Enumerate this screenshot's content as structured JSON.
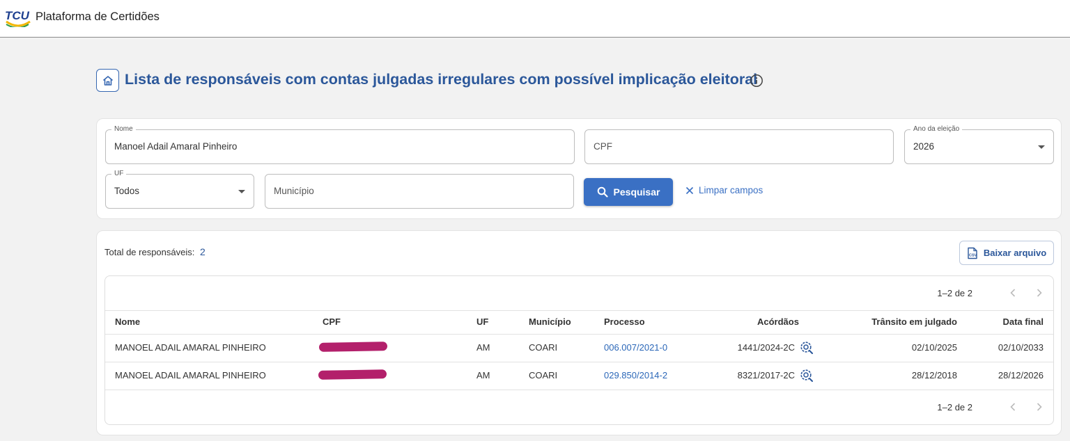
{
  "header": {
    "logo_text": "TCU",
    "app_title": "Plataforma de Certidões"
  },
  "page": {
    "title": "Lista de responsáveis com contas julgadas irregulares com possível implicação eleitoral"
  },
  "filters": {
    "nome": {
      "label": "Nome",
      "value": "Manoel Adail Amaral Pinheiro"
    },
    "cpf": {
      "placeholder": "CPF"
    },
    "ano": {
      "label": "Ano da eleição",
      "value": "2026"
    },
    "uf": {
      "label": "UF",
      "value": "Todos"
    },
    "municipio": {
      "placeholder": "Município"
    },
    "search_label": "Pesquisar",
    "clear_label": "Limpar campos"
  },
  "results": {
    "total_label": "Total de responsáveis:",
    "total_count": "2",
    "download_label": "Baixar arquivo",
    "pager_range": "1–2 de 2",
    "columns": [
      "Nome",
      "CPF",
      "UF",
      "Município",
      "Processo",
      "Acórdãos",
      "Trânsito em julgado",
      "Data final"
    ],
    "rows": [
      {
        "nome": "MANOEL ADAIL AMARAL PINHEIRO",
        "uf": "AM",
        "municipio": "COARI",
        "processo": "006.007/2021-0",
        "acordao": "1441/2024-2C",
        "transito": "02/10/2025",
        "data_final": "02/10/2033"
      },
      {
        "nome": "MANOEL ADAIL AMARAL PINHEIRO",
        "uf": "AM",
        "municipio": "COARI",
        "processo": "029.850/2014-2",
        "acordao": "8321/2017-2C",
        "transito": "28/12/2018",
        "data_final": "28/12/2026"
      }
    ]
  },
  "colors": {
    "primary": "#3a70c4",
    "title_blue": "#2b579a",
    "link_blue": "#2b67b8",
    "redaction": "#b3206b"
  },
  "icons": [
    "tcu-logo",
    "home-icon",
    "info-icon",
    "search-icon",
    "close-icon",
    "chevron-down-icon",
    "csv-file-icon",
    "chevron-left-icon",
    "chevron-right-icon",
    "search-document-icon"
  ]
}
